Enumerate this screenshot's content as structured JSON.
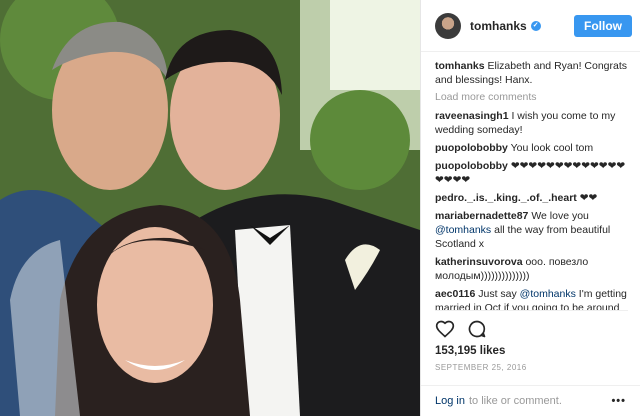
{
  "header": {
    "username": "tomhanks",
    "follow_label": "Follow"
  },
  "caption": {
    "user": "tomhanks",
    "text": "Elizabeth and Ryan! Congrats and blessings! Hanx."
  },
  "load_more": "Load more comments",
  "comments": [
    {
      "user": "raveenasingh1",
      "text": "I wish you come to my wedding someday!"
    },
    {
      "user": "puopolobobby",
      "text": "You look cool tom"
    },
    {
      "user": "puopolobobby",
      "text": "❤❤❤❤❤❤❤❤❤❤❤❤❤❤❤❤❤"
    },
    {
      "user": "pedro._.is._.king._.of._.heart",
      "text": "❤❤"
    },
    {
      "user": "mariabernadette87",
      "text": "We love you",
      "mention": "@tomhanks",
      "tail": "all the way from beautiful Scotland x"
    },
    {
      "user": "katherinsuvorova",
      "text": "ооо. повезло молодым))))))))))))))"
    },
    {
      "user": "aec0116",
      "text": "Just say",
      "mention": "@tomhanks",
      "tail": "I'm getting married in Oct if you going to be around the GTA and looking for some good"
    }
  ],
  "likes": "153,195 likes",
  "date": "SEPTEMBER 25, 2016",
  "login": {
    "link": "Log in",
    "text": "to like or comment.",
    "more_icon": "•••"
  },
  "icons": {
    "heart": "heart-icon",
    "comment": "comment-icon",
    "verified": "verified-badge-icon"
  },
  "colors": {
    "accent": "#3897f0",
    "link": "#003569"
  }
}
